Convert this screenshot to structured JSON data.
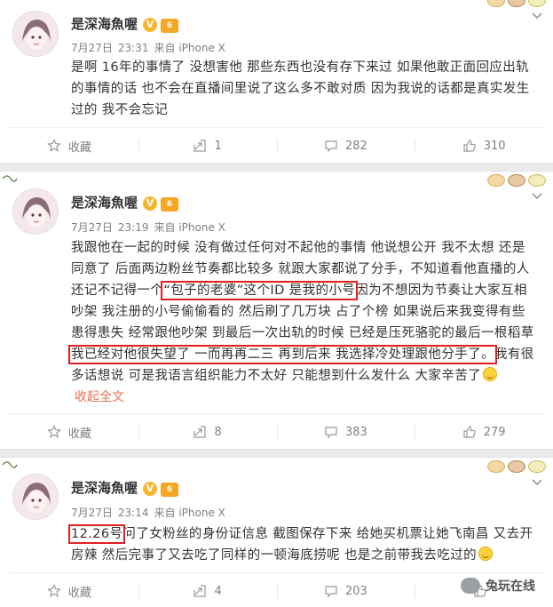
{
  "posts": [
    {
      "author": "是深海魚喔",
      "meta": {
        "date": "7月27日",
        "time": "23:31",
        "source": "来自 iPhone X"
      },
      "lines": [
        "是啊 16年的事情了 没想害他 那些东西也没有存下来过 如果他敢正面回应出轨",
        "的事情的话 也不会在直播间里说了这么多不敢对质 因为我说的话都是真实发生",
        "过的 我不会忘记"
      ],
      "actions": {
        "favorite": "收藏",
        "repost": "1",
        "comment": "282",
        "like": "310"
      }
    },
    {
      "author": "是深海魚喔",
      "meta": {
        "date": "7月27日",
        "time": "23:19",
        "source": "来自 iPhone X"
      },
      "lines": [
        "我跟他在一起的时候 没有做过任何对不起他的事情 他说想公开 我不太想 还是",
        "同意了 后面两边粉丝节奏都比较多 就跟大家都说了分手，不知道看他直播的人",
        "还记不记得一个",
        "“包子的老婆”这个ID 是我的小号",
        "因为不想因为节奏让大家互相",
        "吵架 我注册的小号偷偷看的 然后刷了几万块 占了个榜 如果说后来我变得有些",
        "患得患失 经常跟他吵架 到最后一次出轨的时候 已经是压死骆驼的最后一根稻草",
        "我已经对他很失望了 一而再再二三 再到后来 我选择冷处理跟他分手了。",
        "我有很",
        "多话想说 可是我语言组织能力不太好 只能想到什么发什么 大家辛苦了"
      ],
      "collapse": "收起全文",
      "actions": {
        "favorite": "收藏",
        "repost": "8",
        "comment": "383",
        "like": "279"
      }
    },
    {
      "author": "是深海魚喔",
      "meta": {
        "date": "7月27日",
        "time": "23:14",
        "source": "来自 iPhone X"
      },
      "lines": [
        "12.26号",
        "问了女粉丝的身份证信息 截图保存下来 给她买机票让她飞南昌 又去开",
        "房辣 然后完事了又去吃了同样的一顿海底捞呢 也是之前带我去吃过的"
      ],
      "actions": {
        "favorite": "收藏",
        "repost": "4",
        "comment": "203",
        "like": ""
      }
    }
  ],
  "badges": {
    "verified": "V",
    "level": "6"
  },
  "watermark": "兔玩在线",
  "icons": [
    "star-icon",
    "repost-icon",
    "comment-icon",
    "like-icon",
    "chevron-down-icon",
    "smile-emoji-icon"
  ],
  "colors": {
    "highlight": "#e02020",
    "link": "#eb7350",
    "meta": "#808080"
  }
}
